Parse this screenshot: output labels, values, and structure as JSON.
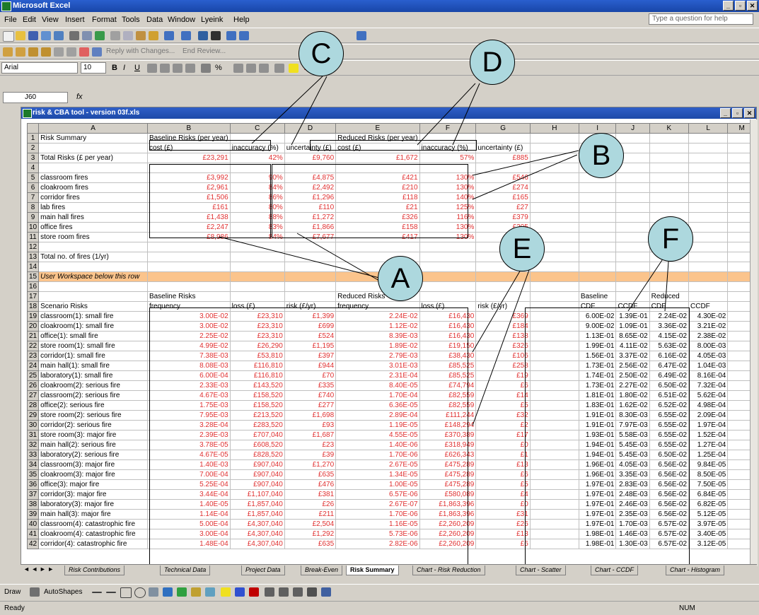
{
  "app": {
    "title": "Microsoft Excel"
  },
  "menu": [
    "File",
    "Edit",
    "View",
    "Insert",
    "Format",
    "Tools",
    "Data",
    "Window",
    "Lyeink",
    "Help"
  ],
  "ask_placeholder": "Type a question for help",
  "toolbar": {
    "font_name": "Arial",
    "font_size": "10",
    "reply_text": "Reply with Changes...",
    "end_review": "End Review..."
  },
  "namebox": {
    "ref": "J60"
  },
  "workbook": {
    "title": "risk & CBA tool - version 03f.xls"
  },
  "col_headers": [
    "A",
    "B",
    "C",
    "D",
    "E",
    "F",
    "G",
    "H",
    "I",
    "J",
    "K",
    "L",
    "M"
  ],
  "rows": [
    {
      "n": "1",
      "a": "Risk Summary",
      "b": "Baseline Risks (per year)",
      "e": "Reduced Risks (per year)"
    },
    {
      "n": "2",
      "b": "cost (£)",
      "c": "inaccuracy (%)",
      "d": "uncertainty (£)",
      "e": "cost (£)",
      "f": "inaccuracy (%)",
      "g": "uncertainty (£)"
    },
    {
      "n": "3",
      "a": "Total Risks (£ per year)",
      "b": "£23,291",
      "c": "42%",
      "d": "£9,760",
      "e": "£1,672",
      "f": "57%",
      "g": "£885"
    },
    {
      "n": "4"
    },
    {
      "n": "5",
      "a": "classroom fires",
      "b": "£3,992",
      "c": "90%",
      "d": "£4,875",
      "e": "£421",
      "f": "130%",
      "g": "£546"
    },
    {
      "n": "6",
      "a": "cloakroom fires",
      "b": "£2,961",
      "c": "84%",
      "d": "£2,492",
      "e": "£210",
      "f": "130%",
      "g": "£274"
    },
    {
      "n": "7",
      "a": "corridor fires",
      "b": "£1,506",
      "c": "86%",
      "d": "£1,296",
      "e": "£118",
      "f": "140%",
      "g": "£165"
    },
    {
      "n": "8",
      "a": "lab fires",
      "b": "£161",
      "c": "80%",
      "d": "£110",
      "e": "£21",
      "f": "125%",
      "g": "£27"
    },
    {
      "n": "9",
      "a": "main hall fires",
      "b": "£1,438",
      "c": "88%",
      "d": "£1,272",
      "e": "£326",
      "f": "116%",
      "g": "£379"
    },
    {
      "n": "10",
      "a": "office fires",
      "b": "£2,247",
      "c": "83%",
      "d": "£1,866",
      "e": "£158",
      "f": "130%",
      "g": "£205"
    },
    {
      "n": "11",
      "a": "store room fires",
      "b": "£8,986",
      "c": "84%",
      "d": "£7,677",
      "e": "£417",
      "f": "130%",
      "g": "£773"
    },
    {
      "n": "12"
    },
    {
      "n": "13",
      "a": "Total no. of fires (1/yr)"
    },
    {
      "n": "14"
    },
    {
      "n": "15",
      "a": "User Workspace below this row",
      "band": true
    },
    {
      "n": "16"
    },
    {
      "n": "17",
      "b": "Baseline Risks",
      "e": "Reduced Risks",
      "i": "Baseline",
      "k": "Reduced"
    },
    {
      "n": "18",
      "a": "Scenario Risks",
      "b": "frequency",
      "c": "loss (£)",
      "d": "risk (£/yr)",
      "e": "frequency",
      "f": "loss (£)",
      "g": "risk (£/yr)",
      "i": "CDF",
      "j": "CCDF",
      "k": "CDF",
      "l": "CCDF"
    },
    {
      "n": "19",
      "a": "classroom(1): small fire",
      "b": "3.00E-02",
      "c": "£23,310",
      "d": "£1,399",
      "e": "2.24E-02",
      "f": "£16,430",
      "g": "£369",
      "i": "6.00E-02",
      "j": "1.39E-01",
      "k": "2.24E-02",
      "l": "4.30E-02"
    },
    {
      "n": "20",
      "a": "cloakroom(1): small fire",
      "b": "3.00E-02",
      "c": "£23,310",
      "d": "£699",
      "e": "1.12E-02",
      "f": "£16,430",
      "g": "£184",
      "i": "9.00E-02",
      "j": "1.09E-01",
      "k": "3.36E-02",
      "l": "3.21E-02"
    },
    {
      "n": "21",
      "a": "office(1): small fire",
      "b": "2.25E-02",
      "c": "£23,310",
      "d": "£524",
      "e": "8.39E-03",
      "f": "£16,430",
      "g": "£138",
      "i": "1.13E-01",
      "j": "8.65E-02",
      "k": "4.15E-02",
      "l": "2.38E-02"
    },
    {
      "n": "22",
      "a": "store room(1): small fire",
      "b": "4.99E-02",
      "c": "£26,290",
      "d": "£1,195",
      "e": "1.89E-02",
      "f": "£19,150",
      "g": "£326",
      "i": "1.99E-01",
      "j": "4.11E-02",
      "k": "5.63E-02",
      "l": "8.00E-03"
    },
    {
      "n": "23",
      "a": "corridor(1): small fire",
      "b": "7.38E-03",
      "c": "£53,810",
      "d": "£397",
      "e": "2.79E-03",
      "f": "£38,430",
      "g": "£106",
      "i": "1.56E-01",
      "j": "3.37E-02",
      "k": "6.16E-02",
      "l": "4.05E-03"
    },
    {
      "n": "24",
      "a": "main hall(1): small fire",
      "b": "8.08E-03",
      "c": "£116,810",
      "d": "£944",
      "e": "3.01E-03",
      "f": "£85,525",
      "g": "£258",
      "i": "1.73E-01",
      "j": "2.56E-02",
      "k": "6.47E-02",
      "l": "1.04E-03"
    },
    {
      "n": "25",
      "a": "laboratory(1): small fire",
      "b": "6.00E-04",
      "c": "£116,810",
      "d": "£70",
      "e": "2.31E-04",
      "f": "£85,525",
      "g": "£19",
      "i": "1.74E-01",
      "j": "2.50E-02",
      "k": "6.49E-02",
      "l": "8.16E-04"
    },
    {
      "n": "26",
      "a": "cloakroom(2): serious fire",
      "b": "2.33E-03",
      "c": "£143,520",
      "d": "£335",
      "e": "8.40E-05",
      "f": "£74,794",
      "g": "£6",
      "i": "1.73E-01",
      "j": "2.27E-02",
      "k": "6.50E-02",
      "l": "7.32E-04"
    },
    {
      "n": "27",
      "a": "classroom(2): serious fire",
      "b": "4.67E-03",
      "c": "£158,520",
      "d": "£740",
      "e": "1.70E-04",
      "f": "£82,559",
      "g": "£14",
      "i": "1.81E-01",
      "j": "1.80E-02",
      "k": "6.51E-02",
      "l": "5.62E-04"
    },
    {
      "n": "28",
      "a": "office(2): serious fire",
      "b": "1.75E-03",
      "c": "£158,520",
      "d": "£277",
      "e": "6.36E-05",
      "f": "£82,559",
      "g": "£5",
      "i": "1.83E-01",
      "j": "1.62E-02",
      "k": "6.52E-02",
      "l": "4.98E-04"
    },
    {
      "n": "29",
      "a": "store room(2): serious fire",
      "b": "7.95E-03",
      "c": "£213,520",
      "d": "£1,698",
      "e": "2.89E-04",
      "f": "£111,244",
      "g": "£32",
      "i": "1.91E-01",
      "j": "8.30E-03",
      "k": "6.55E-02",
      "l": "2.09E-04"
    },
    {
      "n": "30",
      "a": "corridor(2): serious fire",
      "b": "3.28E-04",
      "c": "£283,520",
      "d": "£93",
      "e": "1.19E-05",
      "f": "£148,294",
      "g": "£2",
      "i": "1.91E-01",
      "j": "7.97E-03",
      "k": "6.55E-02",
      "l": "1.97E-04"
    },
    {
      "n": "31",
      "a": "store room(3): major fire",
      "b": "2.39E-03",
      "c": "£707,040",
      "d": "£1,687",
      "e": "4.55E-05",
      "f": "£370,389",
      "g": "£17",
      "i": "1.93E-01",
      "j": "5.58E-03",
      "k": "6.55E-02",
      "l": "1.52E-04"
    },
    {
      "n": "32",
      "a": "main hall(2): serious fire",
      "b": "3.78E-05",
      "c": "£608,520",
      "d": "£23",
      "e": "1.40E-06",
      "f": "£318,949",
      "g": "£0",
      "i": "1.94E-01",
      "j": "5.45E-03",
      "k": "6.55E-02",
      "l": "1.27E-04"
    },
    {
      "n": "33",
      "a": "laboratory(2): serious fire",
      "b": "4.67E-05",
      "c": "£828,520",
      "d": "£39",
      "e": "1.70E-06",
      "f": "£626,343",
      "g": "£1",
      "i": "1.94E-01",
      "j": "5.45E-03",
      "k": "6.50E-02",
      "l": "1.25E-04"
    },
    {
      "n": "34",
      "a": "classroom(3): major fire",
      "b": "1.40E-03",
      "c": "£907,040",
      "d": "£1,270",
      "e": "2.67E-05",
      "f": "£475,289",
      "g": "£13",
      "i": "1.96E-01",
      "j": "4.05E-03",
      "k": "6.56E-02",
      "l": "9.84E-05"
    },
    {
      "n": "35",
      "a": "cloakroom(3): major fire",
      "b": "7.00E-04",
      "c": "£907,040",
      "d": "£635",
      "e": "1.34E-05",
      "f": "£475,289",
      "g": "£6",
      "i": "1.96E-01",
      "j": "3.35E-03",
      "k": "6.56E-02",
      "l": "8.50E-05"
    },
    {
      "n": "36",
      "a": "office(3): major fire",
      "b": "5.25E-04",
      "c": "£907,040",
      "d": "£476",
      "e": "1.00E-05",
      "f": "£475,289",
      "g": "£5",
      "i": "1.97E-01",
      "j": "2.83E-03",
      "k": "6.56E-02",
      "l": "7.50E-05"
    },
    {
      "n": "37",
      "a": "corridor(3): major fire",
      "b": "3.44E-04",
      "c": "£1,107,040",
      "d": "£381",
      "e": "6.57E-06",
      "f": "£580,089",
      "g": "£4",
      "i": "1.97E-01",
      "j": "2.48E-03",
      "k": "6.56E-02",
      "l": "6.84E-05"
    },
    {
      "n": "38",
      "a": "laboratory(3): major fire",
      "b": "1.40E-05",
      "c": "£1,857,040",
      "d": "£26",
      "e": "2.67E-07",
      "f": "£1,863,396",
      "g": "£0",
      "i": "1.97E-01",
      "j": "2.46E-03",
      "k": "6.56E-02",
      "l": "6.82E-05"
    },
    {
      "n": "39",
      "a": "main hall(3): major fire",
      "b": "1.14E-04",
      "c": "£1,857,040",
      "d": "£211",
      "e": "1.70E-06",
      "f": "£1,863,396",
      "g": "£31",
      "i": "1.97E-01",
      "j": "2.35E-03",
      "k": "6.56E-02",
      "l": "5.12E-05"
    },
    {
      "n": "40",
      "a": "classroom(4): catastrophic fire",
      "b": "5.00E-04",
      "c": "£4,307,040",
      "d": "£2,504",
      "e": "1.16E-05",
      "f": "£2,260,209",
      "g": "£26",
      "i": "1.97E-01",
      "j": "1.70E-03",
      "k": "6.57E-02",
      "l": "3.97E-05"
    },
    {
      "n": "41",
      "a": "cloakroom(4): catastrophic fire",
      "b": "3.00E-04",
      "c": "£4,307,040",
      "d": "£1,292",
      "e": "5.73E-06",
      "f": "£2,260,209",
      "g": "£13",
      "i": "1.98E-01",
      "j": "1.46E-03",
      "k": "6.57E-02",
      "l": "3.40E-05"
    },
    {
      "n": "42",
      "a": "corridor(4): catastrophic fire",
      "b": "1.48E-04",
      "c": "£4,307,040",
      "d": "£635",
      "e": "2.82E-06",
      "f": "£2,260,209",
      "g": "£6",
      "i": "1.98E-01",
      "j": "1.30E-03",
      "k": "6.57E-02",
      "l": "3.12E-05"
    }
  ],
  "sheet_tabs": [
    "Risk Contributions",
    "Technical Data",
    "Project Data",
    "Break-Even",
    "Risk Summary",
    "Chart - Risk Reduction",
    "Chart - Scatter",
    "Chart - CCDF",
    "Chart - Histogram"
  ],
  "active_tab": "Risk Summary",
  "callouts": {
    "a": "A",
    "b": "B",
    "c": "C",
    "d": "D",
    "e": "E",
    "f": "F"
  },
  "drawbar": {
    "draw": "Draw",
    "autoshapes": "AutoShapes"
  },
  "status": {
    "ready": "Ready",
    "num": "NUM"
  }
}
